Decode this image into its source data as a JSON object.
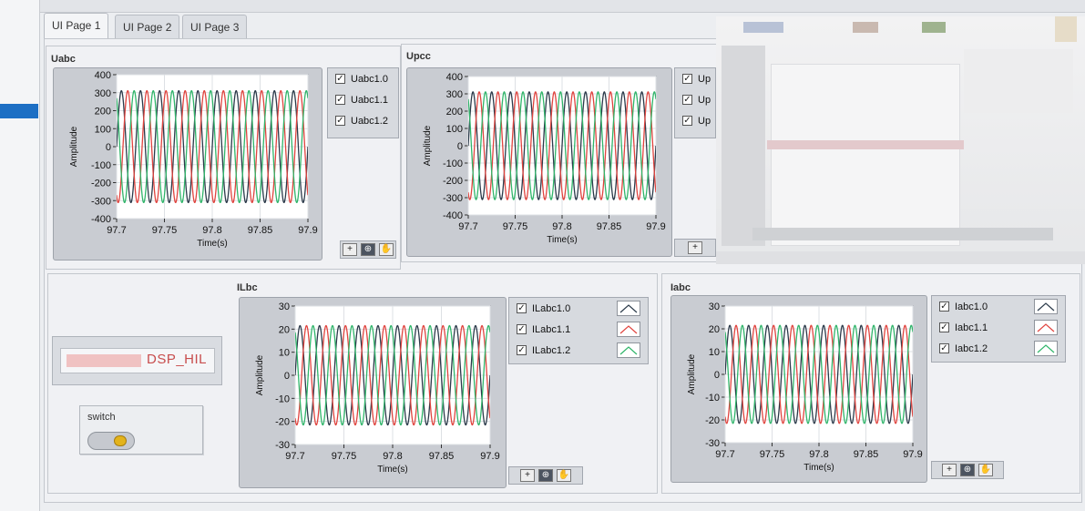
{
  "tabs": [
    {
      "label": "UI Page 1",
      "active": true
    },
    {
      "label": "UI Page 2",
      "active": false
    },
    {
      "label": "UI Page 3",
      "active": false
    }
  ],
  "dsp": {
    "label": "DSP_HIL"
  },
  "switch": {
    "label": "switch",
    "state": "on"
  },
  "tools": {
    "cursor_icon": "crosshair-icon",
    "zoom_icon": "zoom-icon",
    "pan_icon": "hand-pan-icon"
  },
  "colors": {
    "series0": "#2b3a4a",
    "series1": "#e0443f",
    "series2": "#30b56a"
  },
  "chart_data": [
    {
      "type": "line",
      "title": "Uabc",
      "xlabel": "Time(s)",
      "ylabel": "Amplitude",
      "xlim": [
        97.7,
        97.9
      ],
      "ylim": [
        -400,
        400
      ],
      "xticks": [
        "97.7",
        "97.75",
        "97.8",
        "97.85",
        "97.9"
      ],
      "yticks": [
        "400",
        "300",
        "200",
        "100",
        "0",
        "-100",
        "-200",
        "-300",
        "-400"
      ],
      "amplitude": 311,
      "frequency_hz": 50,
      "phase_shift_deg": [
        0,
        -120,
        120
      ],
      "series": [
        {
          "name": "Uabc1.0",
          "checked": true
        },
        {
          "name": "Uabc1.1",
          "checked": true
        },
        {
          "name": "Uabc1.2",
          "checked": true
        }
      ]
    },
    {
      "type": "line",
      "title": "Upcc",
      "xlabel": "Time(s)",
      "ylabel": "Amplitude",
      "xlim": [
        97.7,
        97.9
      ],
      "ylim": [
        -400,
        400
      ],
      "xticks": [
        "97.7",
        "97.75",
        "97.8",
        "97.85",
        "97.9"
      ],
      "yticks": [
        "400",
        "300",
        "200",
        "100",
        "0",
        "-100",
        "-200",
        "-300",
        "-400"
      ],
      "amplitude": 311,
      "frequency_hz": 50,
      "phase_shift_deg": [
        0,
        -120,
        120
      ],
      "series": [
        {
          "name": "Up",
          "checked": true
        },
        {
          "name": "Up",
          "checked": true
        },
        {
          "name": "Up",
          "checked": true
        }
      ]
    },
    {
      "type": "line",
      "title": "ILbc",
      "xlabel": "Time(s)",
      "ylabel": "Amplitude",
      "xlim": [
        97.7,
        97.9
      ],
      "ylim": [
        -30,
        30
      ],
      "xticks": [
        "97.7",
        "97.75",
        "97.8",
        "97.85",
        "97.9"
      ],
      "yticks": [
        "30",
        "20",
        "10",
        "0",
        "-10",
        "-20",
        "-30"
      ],
      "amplitude": 21.5,
      "frequency_hz": 50,
      "phase_shift_deg": [
        0,
        -120,
        120
      ],
      "series": [
        {
          "name": "ILabc1.0",
          "checked": true
        },
        {
          "name": "ILabc1.1",
          "checked": true
        },
        {
          "name": "ILabc1.2",
          "checked": true
        }
      ]
    },
    {
      "type": "line",
      "title": "Iabc",
      "xlabel": "Time(s)",
      "ylabel": "Amplitude",
      "xlim": [
        97.7,
        97.9
      ],
      "ylim": [
        -30,
        30
      ],
      "xticks": [
        "97.7",
        "97.75",
        "97.8",
        "97.85",
        "97.9"
      ],
      "yticks": [
        "30",
        "20",
        "10",
        "0",
        "-10",
        "-20",
        "-30"
      ],
      "amplitude": 21.5,
      "frequency_hz": 50,
      "phase_shift_deg": [
        0,
        -120,
        120
      ],
      "series": [
        {
          "name": "Iabc1.0",
          "checked": true
        },
        {
          "name": "Iabc1.1",
          "checked": true
        },
        {
          "name": "Iabc1.2",
          "checked": true
        }
      ]
    }
  ]
}
